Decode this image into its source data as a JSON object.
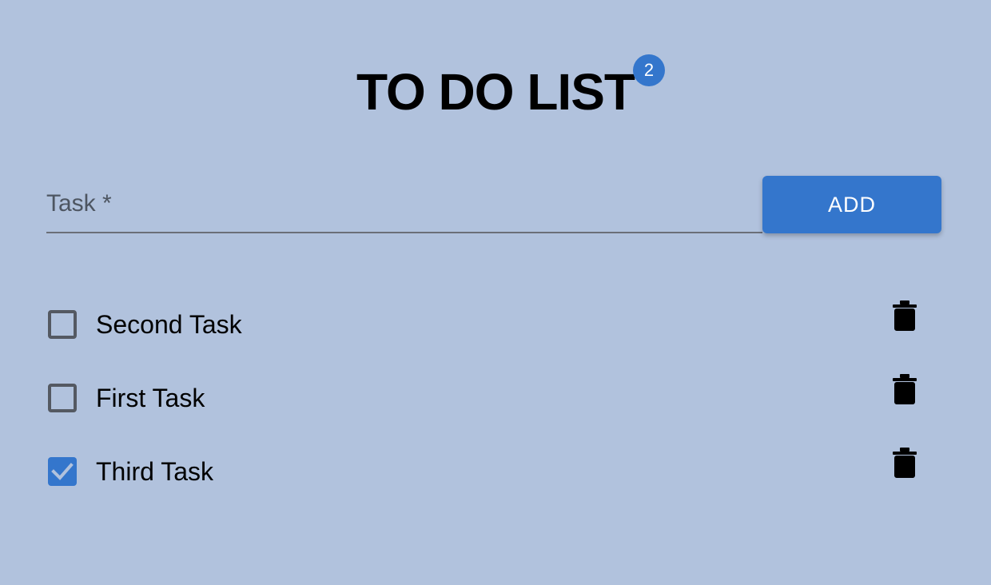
{
  "header": {
    "title": "TO DO LIST",
    "badge_count": "2"
  },
  "form": {
    "task_label": "Task *",
    "task_value": "",
    "add_label": "ADD"
  },
  "tasks": [
    {
      "label": "Second Task",
      "checked": false
    },
    {
      "label": "First Task",
      "checked": false
    },
    {
      "label": "Third Task",
      "checked": true
    }
  ],
  "colors": {
    "background": "#b1c2dd",
    "accent": "#3476cc",
    "text": "#000000"
  },
  "icons": {
    "checkbox_unchecked": "checkbox-outline-icon",
    "checkbox_checked": "checkmark-icon",
    "delete": "trash-icon"
  }
}
